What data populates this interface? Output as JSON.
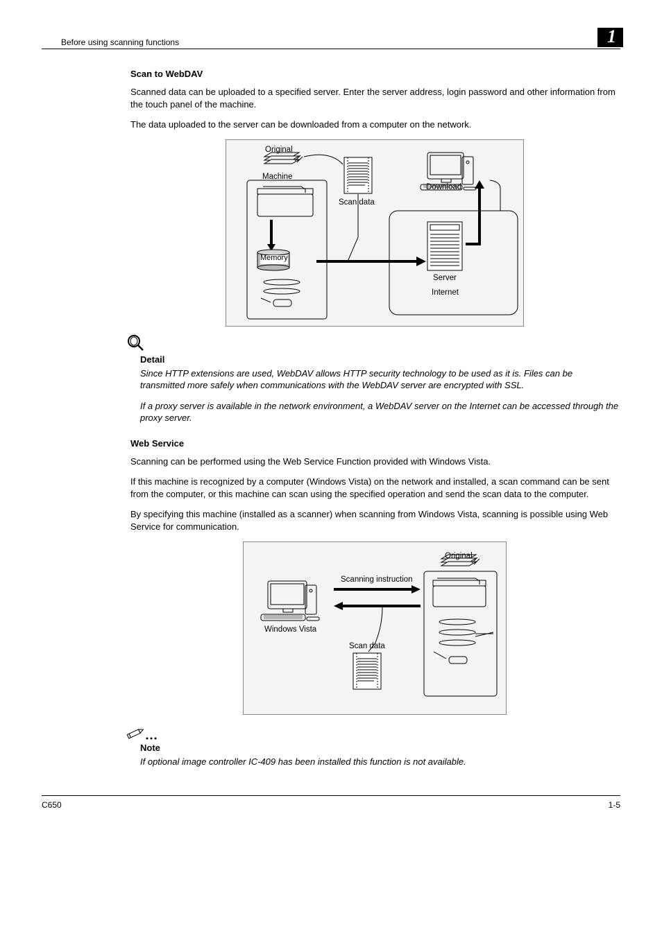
{
  "header": {
    "section": "Before using scanning functions",
    "chapter": "1"
  },
  "webdav": {
    "title": "Scan to WebDAV",
    "p1": "Scanned data can be uploaded to a specified server. Enter the server address, login password and other information from the touch panel of the machine.",
    "p2": "The data uploaded to the server can be downloaded from a computer on the network.",
    "diag": {
      "original": "Original",
      "machine": "Machine",
      "memory": "Memory",
      "scandata": "Scan data",
      "download": "Download",
      "server": "Server",
      "internet": "Internet"
    }
  },
  "detail": {
    "heading": "Detail",
    "p1": "Since HTTP extensions are used, WebDAV allows HTTP security technology to be used as it is. Files can be transmitted more safely when communications with the WebDAV server are encrypted with SSL.",
    "p2": "If a proxy server is available in the network environment, a WebDAV server on the Internet can be accessed through the proxy server."
  },
  "webservice": {
    "title": "Web Service",
    "p1": "Scanning can be performed using the Web Service Function provided with Windows Vista.",
    "p2": "If this machine is recognized by a computer (Windows Vista) on the network and installed, a scan command can be sent from the computer, or this machine can scan using the specified operation and send the scan data to the computer.",
    "p3": "By specifying this machine (installed as a scanner) when scanning from Windows Vista, scanning is possible using Web Service for communication.",
    "diag": {
      "original": "Original",
      "scaninstr": "Scanning instruction",
      "vista": "Windows Vista",
      "scandata": "Scan data"
    }
  },
  "note": {
    "heading": "Note",
    "p1": "If optional image controller IC-409 has been installed this function is not available."
  },
  "footer": {
    "left": "C650",
    "right": "1-5"
  }
}
